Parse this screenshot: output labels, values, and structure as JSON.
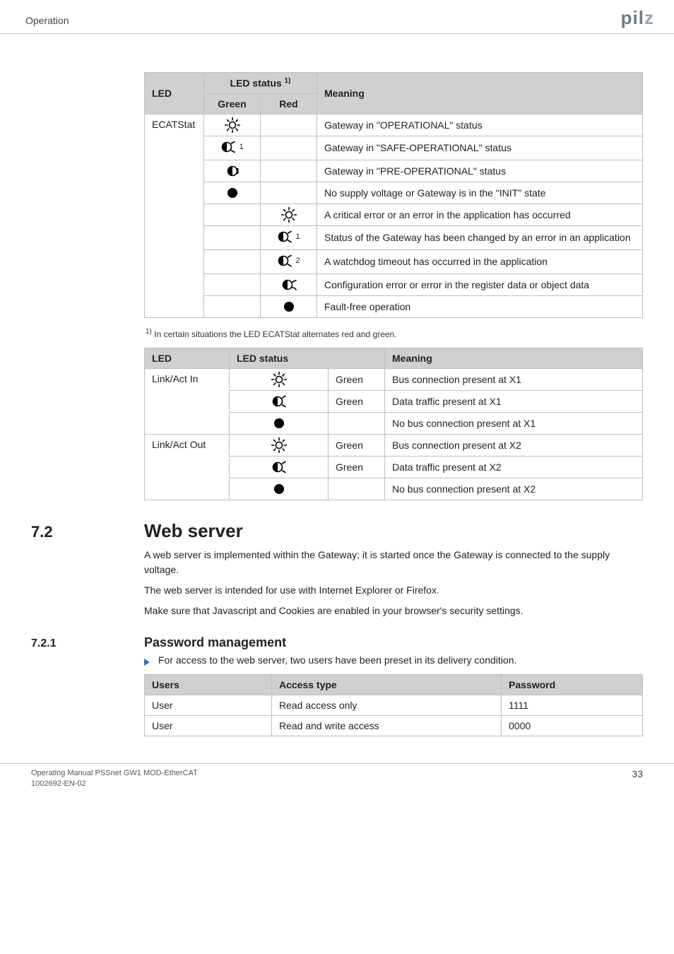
{
  "header": {
    "section": "Operation",
    "brand_main": "pil",
    "brand_tail": "z"
  },
  "t1": {
    "head": {
      "group": "LED status",
      "group_sup": "1)",
      "c1": "LED",
      "c2": "Green",
      "c3": "Red",
      "c4": "Meaning"
    },
    "row_label": "ECATStat",
    "rows": [
      {
        "icon": "sun",
        "col": "g",
        "meaning": "Gateway in \"OPERATIONAL\" status"
      },
      {
        "icon": "halfblink",
        "col": "g",
        "num": "1",
        "meaning": "Gateway in \"SAFE-OPERATIONAL\" status"
      },
      {
        "icon": "halfsteady",
        "col": "g",
        "meaning": "Gateway in \"PRE-OPERATIONAL\" status"
      },
      {
        "icon": "filled",
        "col": "g",
        "meaning": "No supply voltage or Gateway is in the \"INIT\" state"
      },
      {
        "icon": "sun",
        "col": "r",
        "meaning": "A critical error or an error in the application has occurred"
      },
      {
        "icon": "halfblink",
        "col": "r",
        "num": "1",
        "meaning": "Status of the Gateway has been changed by an error in an application"
      },
      {
        "icon": "halfblink",
        "col": "r",
        "num": "2",
        "meaning": "A watchdog timeout has occurred in the application"
      },
      {
        "icon": "halfarrow",
        "col": "r",
        "meaning": "Configuration error or error in the register data or object data"
      },
      {
        "icon": "filled",
        "col": "r",
        "meaning": "Fault-free operation"
      }
    ],
    "footnote_pre": "1)",
    "footnote": "In certain situations the LED ECATStat alternates red and green."
  },
  "t2": {
    "head": {
      "c1": "LED",
      "c2": "LED status",
      "c4": "Meaning"
    },
    "groups": [
      {
        "label": "Link/Act In",
        "rows": [
          {
            "icon": "sun",
            "color": "Green",
            "meaning": "Bus connection present at X1"
          },
          {
            "icon": "halfblink",
            "color": "Green",
            "meaning": "Data traffic present at X1"
          },
          {
            "icon": "filled",
            "color": "",
            "meaning": "No bus connection present at X1"
          }
        ]
      },
      {
        "label": "Link/Act Out",
        "rows": [
          {
            "icon": "sun",
            "color": "Green",
            "meaning": "Bus connection present at X2"
          },
          {
            "icon": "halfblink",
            "color": "Green",
            "meaning": "Data traffic present at X2"
          },
          {
            "icon": "filled",
            "color": "",
            "meaning": "No bus connection present at X2"
          }
        ]
      }
    ]
  },
  "sec72": {
    "num": "7.2",
    "title": "Web server",
    "p1": "A web server is implemented within the Gateway; it is started once the Gateway is connected to the supply voltage.",
    "p2": "The web server is intended for use with Internet Explorer or Firefox.",
    "p3": "Make sure that Javascript and Cookies are enabled in your browser's security settings."
  },
  "sec721": {
    "num": "7.2.1",
    "title": "Password management",
    "bullet": "For access to the web server, two users have been preset in its delivery condition."
  },
  "t3": {
    "head": {
      "c1": "Users",
      "c2": "Access type",
      "c3": "Password"
    },
    "rows": [
      {
        "u": "User",
        "a": "Read access only",
        "p": "1111"
      },
      {
        "u": "User",
        "a": "Read and write access",
        "p": "0000"
      }
    ]
  },
  "footer": {
    "l1": "Operating Manual PSSnet GW1 MOD-EtherCAT",
    "l2": "1002692-EN-02",
    "page": "33"
  }
}
